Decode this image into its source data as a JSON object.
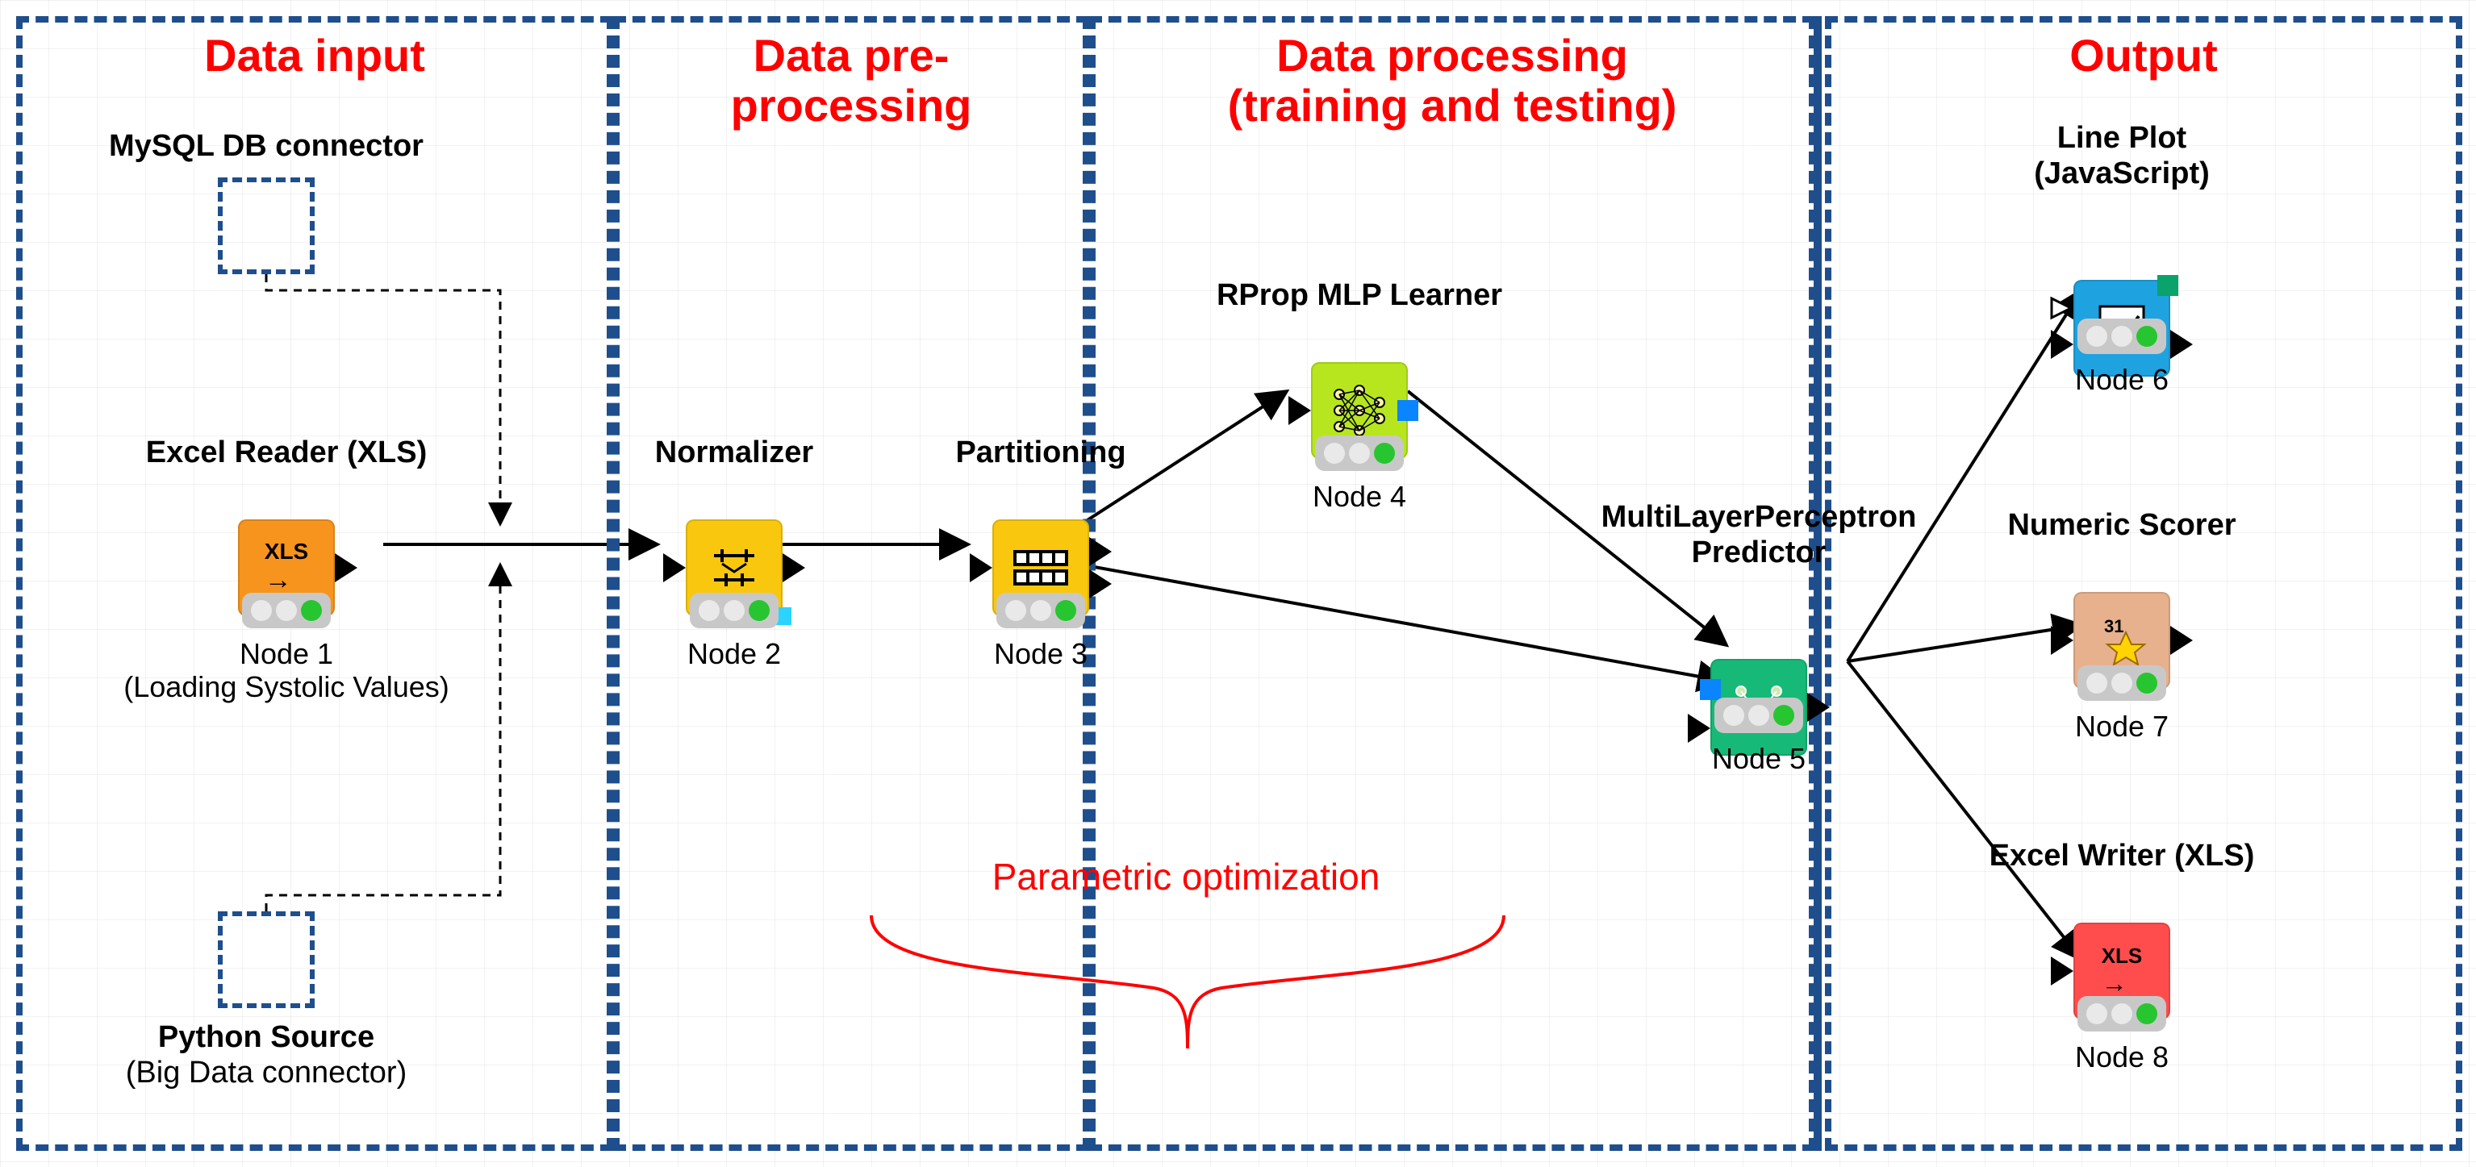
{
  "sections": {
    "data_input": {
      "title": "Data input"
    },
    "preprocessing": {
      "title_line1": "Data pre-",
      "title_line2": "processing"
    },
    "processing": {
      "title_line1": "Data processing",
      "title_line2": "(training and testing)"
    },
    "output": {
      "title": "Output"
    }
  },
  "connectors": {
    "mysql": {
      "label": "MySQL DB connector"
    },
    "python": {
      "label_line1": "Python Source",
      "label_line2": "(Big Data connector)"
    }
  },
  "nodes": {
    "1": {
      "title": "Excel Reader (XLS)",
      "name": "Node 1",
      "subtitle": "(Loading Systolic Values)",
      "icon_text": "XLS",
      "color": "#f7941d"
    },
    "2": {
      "title": "Normalizer",
      "name": "Node 2",
      "color": "#f9c80e"
    },
    "3": {
      "title": "Partitioning",
      "name": "Node 3",
      "color": "#f9c80e"
    },
    "4": {
      "title": "RProp MLP Learner",
      "name": "Node 4",
      "color": "#b7e61e"
    },
    "5": {
      "title_line1": "MultiLayerPerceptron",
      "title_line2": "Predictor",
      "name": "Node 5",
      "color": "#17b978"
    },
    "6": {
      "title_line1": "Line Plot",
      "title_line2": "(JavaScript)",
      "name": "Node 6",
      "color": "#1ea3e0"
    },
    "7": {
      "title": "Numeric Scorer",
      "name": "Node 7",
      "color": "#e7b18e"
    },
    "8": {
      "title": "Excel Writer (XLS)",
      "name": "Node 8",
      "icon_text": "XLS",
      "color": "#ff4d4d"
    }
  },
  "annotations": {
    "parametric": "Parametric optimization"
  }
}
